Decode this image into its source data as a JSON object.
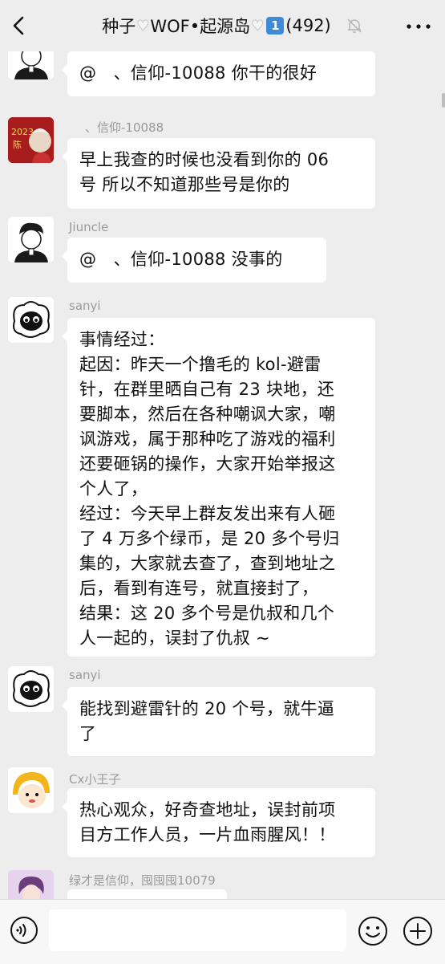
{
  "header": {
    "title_prefix": "种子",
    "title_mid": "WOF•起源岛",
    "title_badge": "1",
    "title_count": "(492)"
  },
  "messages": [
    {
      "sender": "Jiuncle",
      "lines": [
        "@　、信仰-10088  你干的很好"
      ]
    },
    {
      "sender": "、信仰-10088",
      "lines": [
        "早上我查的时候也没看到你的 06",
        "号  所以不知道那些号是你的"
      ]
    },
    {
      "sender": "Jiuncle",
      "lines": [
        "@　、信仰-10088  没事的"
      ]
    },
    {
      "sender": "sanyi",
      "lines": [
        "事情经过：",
        "起因：昨天一个撸毛的 kol-避雷",
        "针，在群里晒自己有 23 块地，还",
        "要脚本，然后在各种嘲讽大家，嘲",
        "讽游戏，属于那种吃了游戏的福利",
        "还要砸锅的操作，大家开始举报这",
        "个人了，",
        "经过：今天早上群友发出来有人砸",
        "了 4 万多个绿币，是 20 多个号归",
        "集的，大家就去查了，查到地址之",
        "后，看到有连号，就直接封了，",
        "结果：这 20 多个号是仇叔和几个",
        "人一起的，误封了仇叔 ~"
      ]
    },
    {
      "sender": "sanyi",
      "lines": [
        "能找到避雷针的 20 个号，就牛逼",
        "了"
      ]
    },
    {
      "sender": "Cx小王子",
      "lines": [
        "热心观众，好奇查地址，误封前项",
        "目方工作人员，一片血雨腥风！！"
      ]
    },
    {
      "sender": "绿才是信仰，囤囤囤10079",
      "lines": [
        ""
      ]
    }
  ],
  "composer": {
    "value": "",
    "placeholder": ""
  },
  "colors": {
    "background": "#ededed",
    "bubble": "#ffffff",
    "sender": "#9a9a9a",
    "badge": "#3d8bd6"
  },
  "icons": [
    "back-arrow-icon",
    "mute-bell-icon",
    "more-dots-icon",
    "voice-icon",
    "emoji-icon",
    "plus-icon"
  ]
}
